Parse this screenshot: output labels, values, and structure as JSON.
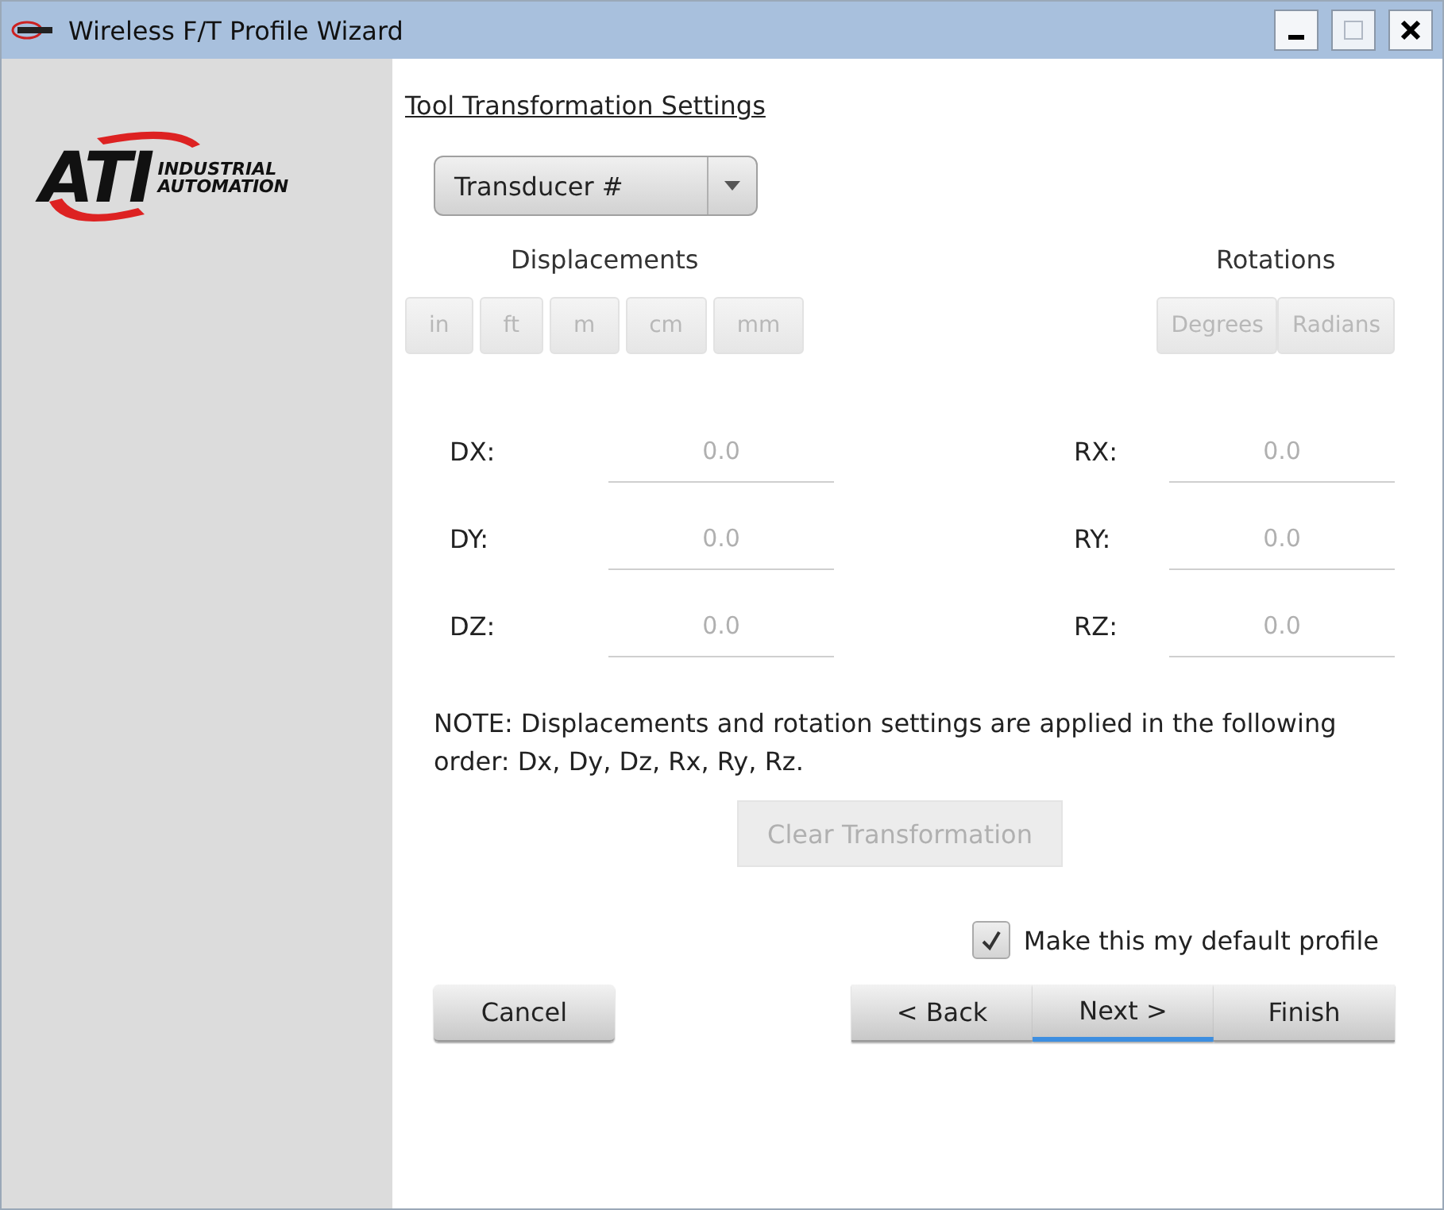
{
  "window": {
    "title": "Wireless F/T Profile Wizard"
  },
  "logo": {
    "mark": "ATI",
    "line_1": "INDUSTRIAL",
    "line_2": "AUTOMATION"
  },
  "heading": "Tool Transformation Settings",
  "transducer_dropdown": {
    "value": "Transducer #"
  },
  "displacements": {
    "label": "Displacements",
    "units": [
      {
        "label": "in",
        "selected": false,
        "disabled": true
      },
      {
        "label": "ft",
        "selected": false,
        "disabled": true
      },
      {
        "label": "m",
        "selected": false,
        "disabled": true
      },
      {
        "label": "cm",
        "selected": false,
        "disabled": true
      },
      {
        "label": "mm",
        "selected": false,
        "disabled": true
      }
    ]
  },
  "rotations": {
    "label": "Rotations",
    "units": [
      {
        "label": "Degrees",
        "selected": false,
        "disabled": true
      },
      {
        "label": "Radians",
        "selected": false,
        "disabled": true
      }
    ]
  },
  "displacement_fields": [
    {
      "label": "DX:",
      "placeholder": "0.0",
      "disabled": true
    },
    {
      "label": "DY:",
      "placeholder": "0.0",
      "disabled": true
    },
    {
      "label": "DZ:",
      "placeholder": "0.0",
      "disabled": true
    }
  ],
  "rotation_fields": [
    {
      "label": "RX:",
      "placeholder": "0.0",
      "disabled": true
    },
    {
      "label": "RY:",
      "placeholder": "0.0",
      "disabled": true
    },
    {
      "label": "RZ:",
      "placeholder": "0.0",
      "disabled": true
    }
  ],
  "note": "NOTE: Displacements and rotation settings are applied in the following order: Dx, Dy, Dz, Rx, Ry, Rz.",
  "clear_button": {
    "label": "Clear Transformation",
    "disabled": true
  },
  "default_profile": {
    "label": "Make this my default profile",
    "checked": true
  },
  "buttons": [
    {
      "label": "Cancel",
      "kind": "single",
      "focused": false
    },
    {
      "label": "< Back",
      "kind": "group",
      "focused": false
    },
    {
      "label": "Next >",
      "kind": "group",
      "focused": true
    },
    {
      "label": "Finish",
      "kind": "group",
      "focused": false
    }
  ]
}
